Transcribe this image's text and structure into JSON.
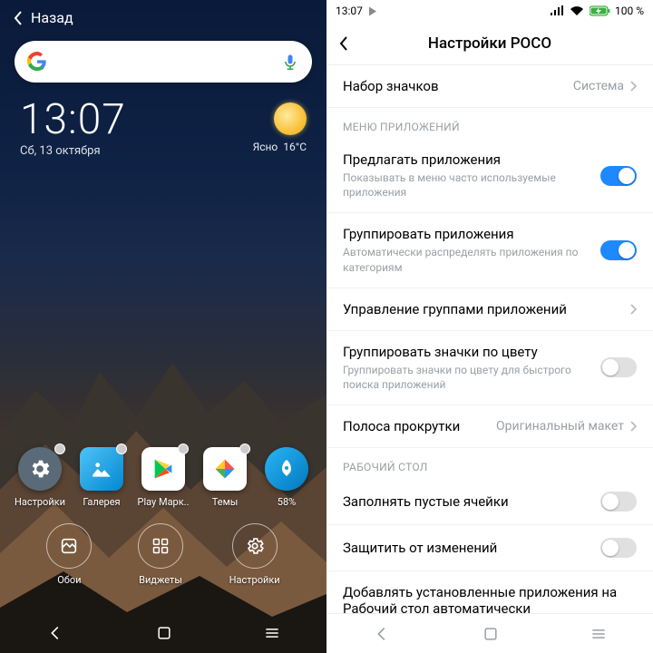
{
  "left": {
    "back_label": "Назад",
    "clock_time": "13:07",
    "clock_date": "Сб, 13 октября",
    "weather_cond": "Ясно",
    "weather_temp": "16°C",
    "apps": {
      "settings": "Настройки",
      "gallery": "Галерея",
      "play": "Play Марк..",
      "themes": "Темы",
      "boost": "58%"
    },
    "tools": {
      "wallpaper": "Обои",
      "widgets": "Виджеты",
      "settings": "Настройки"
    }
  },
  "right": {
    "status": {
      "time": "13:07",
      "battery": "100 %"
    },
    "title": "Настройки POCO",
    "row_iconset": {
      "label": "Набор значков",
      "value": "Система"
    },
    "section_apps": "МЕНЮ ПРИЛОЖЕНИЙ",
    "row_suggest": {
      "label": "Предлагать приложения",
      "sub": "Показывать в меню часто используемые приложения",
      "on": true
    },
    "row_group": {
      "label": "Группировать приложения",
      "sub": "Автоматически распределять приложения по категориям",
      "on": true
    },
    "row_manage_groups": {
      "label": "Управление группами приложений"
    },
    "row_color": {
      "label": "Группировать значки по цвету",
      "sub": "Группировать значки по цвету для быстрого поиска приложений",
      "on": false
    },
    "row_scroll": {
      "label": "Полоса прокрутки",
      "value": "Оригинальный макет"
    },
    "section_home": "РАБОЧИЙ СТОЛ",
    "row_fill": {
      "label": "Заполнять пустые ячейки",
      "on": false
    },
    "row_lock": {
      "label": "Защитить от изменений",
      "on": false
    },
    "row_autoadd": {
      "label": "Добавлять установленные приложения на Рабочий стол автоматически"
    }
  }
}
